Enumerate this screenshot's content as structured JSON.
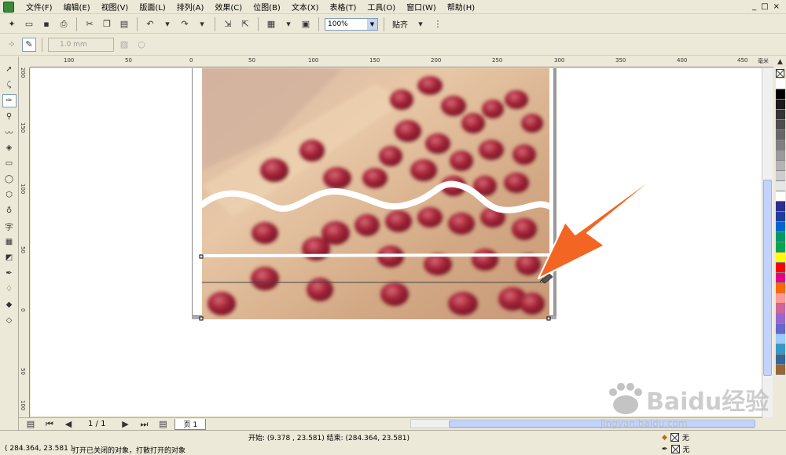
{
  "menu": [
    "文件(F)",
    "编辑(E)",
    "视图(V)",
    "版面(L)",
    "排列(A)",
    "效果(C)",
    "位图(B)",
    "文本(X)",
    "表格(T)",
    "工具(O)",
    "窗口(W)",
    "帮助(H)"
  ],
  "window_controls": [
    "_",
    "□",
    "×"
  ],
  "toolbar": {
    "zoom": "100%",
    "snap_label": "贴齐"
  },
  "propertybar": {
    "nudge_value": "1.0 mm"
  },
  "ruler": {
    "h_ticks": [
      "100",
      "50",
      "0",
      "50",
      "100",
      "150",
      "200",
      "250",
      "300",
      "350",
      "400",
      "450"
    ],
    "h_unit": "毫米",
    "v_ticks": [
      "200",
      "150",
      "100",
      "50",
      "0",
      "50",
      "100"
    ]
  },
  "pagebar": {
    "page_count": "1 / 1",
    "page_tab": "页 1"
  },
  "status": {
    "coords": "( 284.364, 23.581 )",
    "message": "打开已关闭的对象，打散打开的对象",
    "range": "开始: (9.378 , 23.581)  结束: (284.364, 23.581)",
    "fill_label": "无",
    "outline_label": "无"
  },
  "watermark": {
    "brand": "Baidu经验",
    "url": "jingyan.baidu.com"
  },
  "palette": [
    "#ffffff",
    "#000000",
    "#1a1a1a",
    "#333333",
    "#4d4d4d",
    "#666666",
    "#808080",
    "#999999",
    "#b3b3b3",
    "#cccccc",
    "#e6e6e6",
    "#ffffff",
    "#2e2e8f",
    "#1f3f9f",
    "#0066cc",
    "#009966",
    "#00a651",
    "#ffff00",
    "#ff0000",
    "#e6007e",
    "#ff6600",
    "#ff9999",
    "#cc6699",
    "#9966cc",
    "#6666cc",
    "#99ccff",
    "#3399cc",
    "#336699",
    "#996633"
  ],
  "colors": {
    "accent_arrow": "#f26522",
    "chrome": "#ece9d8"
  }
}
